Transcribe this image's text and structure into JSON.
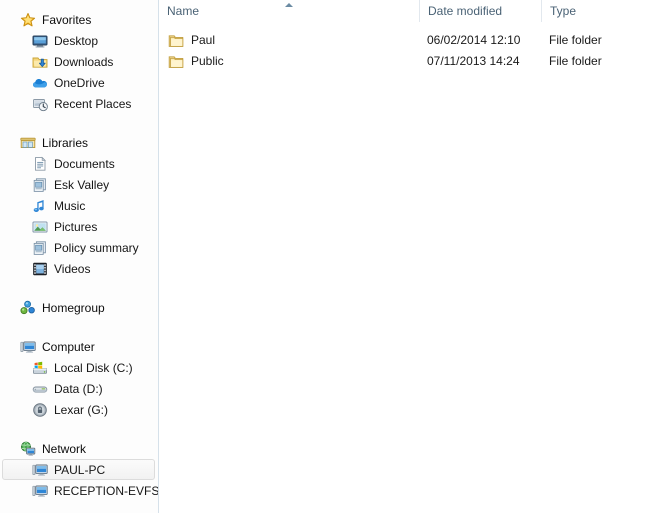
{
  "window": {
    "app": "Windows Explorer",
    "background": "#fdfdfd",
    "divider_color": "#d6e1ea"
  },
  "nav_pane": {
    "name": "navigation-pane",
    "groups": [
      {
        "id": "favorites",
        "root": {
          "label": "Favorites",
          "icon": "star-icon"
        },
        "items": [
          {
            "label": "Desktop",
            "icon": "desktop-icon"
          },
          {
            "label": "Downloads",
            "icon": "downloads-folder-icon"
          },
          {
            "label": "OneDrive",
            "icon": "onedrive-cloud-icon"
          },
          {
            "label": "Recent Places",
            "icon": "recent-places-icon"
          }
        ]
      },
      {
        "id": "libraries",
        "root": {
          "label": "Libraries",
          "icon": "libraries-icon"
        },
        "items": [
          {
            "label": "Documents",
            "icon": "documents-library-icon"
          },
          {
            "label": "Esk Valley",
            "icon": "library-icon"
          },
          {
            "label": "Music",
            "icon": "music-note-icon"
          },
          {
            "label": "Pictures",
            "icon": "pictures-library-icon"
          },
          {
            "label": "Policy summary",
            "icon": "library-icon"
          },
          {
            "label": "Videos",
            "icon": "videos-filmstrip-icon"
          }
        ]
      },
      {
        "id": "homegroup",
        "root": {
          "label": "Homegroup",
          "icon": "homegroup-icon"
        },
        "items": []
      },
      {
        "id": "computer",
        "root": {
          "label": "Computer",
          "icon": "computer-monitor-icon"
        },
        "items": [
          {
            "label": "Local Disk (C:)",
            "icon": "system-drive-icon"
          },
          {
            "label": "Data (D:)",
            "icon": "hard-drive-icon"
          },
          {
            "label": "Lexar (G:)",
            "icon": "locked-drive-icon"
          }
        ]
      },
      {
        "id": "network",
        "root": {
          "label": "Network",
          "icon": "network-globe-icon"
        },
        "items": [
          {
            "label": "PAUL-PC",
            "icon": "computer-monitor-icon",
            "selected": true
          },
          {
            "label": "RECEPTION-EVFS",
            "icon": "computer-monitor-icon",
            "selected": false
          }
        ]
      }
    ]
  },
  "file_list": {
    "name": "file-list",
    "sort_column": "Name",
    "sort_direction": "ascending",
    "columns": [
      {
        "key": "name",
        "label": "Name"
      },
      {
        "key": "date",
        "label": "Date modified"
      },
      {
        "key": "type",
        "label": "Type"
      }
    ],
    "rows": [
      {
        "name": "Paul",
        "date": "06/02/2014 12:10",
        "type": "File folder",
        "icon": "folder-icon"
      },
      {
        "name": "Public",
        "date": "07/11/2013 14:24",
        "type": "File folder",
        "icon": "folder-icon"
      }
    ]
  },
  "colors": {
    "header_text": "#4a6275",
    "body_text": "#1a1a1a",
    "folder_yellow": "#fcd87f",
    "selection_border": "#dcdcdc"
  }
}
